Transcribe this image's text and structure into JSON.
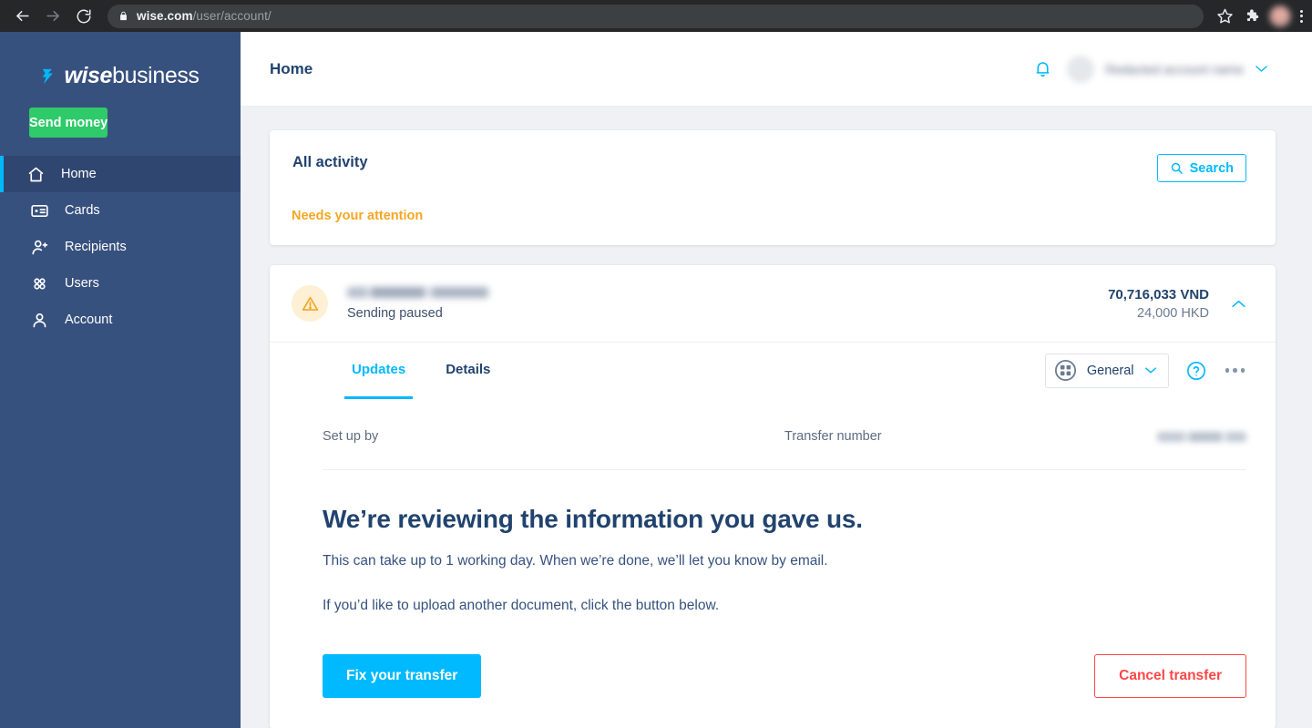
{
  "browser": {
    "back_icon": "arrow-left-icon",
    "forward_icon": "arrow-right-icon",
    "reload_icon": "reload-icon",
    "lock_icon": "lock-icon",
    "url_domain": "wise.com",
    "url_path": "/user/account/",
    "bookmark_icon": "star-icon",
    "extensions_icon": "puzzle-icon",
    "profile_icon": "profile-avatar",
    "menu_icon": "three-dots-vertical-icon"
  },
  "sidebar": {
    "logo_primary": "wise",
    "logo_secondary": "business",
    "send_money_label": "Send money",
    "items": [
      {
        "label": "Home",
        "icon": "home-icon",
        "active": true
      },
      {
        "label": "Cards",
        "icon": "card-icon",
        "active": false
      },
      {
        "label": "Recipients",
        "icon": "recipients-icon",
        "active": false
      },
      {
        "label": "Users",
        "icon": "users-grid-icon",
        "active": false
      },
      {
        "label": "Account",
        "icon": "person-icon",
        "active": false
      }
    ]
  },
  "header": {
    "title": "Home",
    "notifications_icon": "bell-icon",
    "account_name": "",
    "account_chevron_icon": "chevron-down-icon"
  },
  "activity": {
    "title": "All activity",
    "search_label": "Search",
    "search_icon": "search-icon",
    "needs_attention_label": "Needs your attention"
  },
  "transfer": {
    "status_icon": "warning-triangle-icon",
    "recipient_name": "",
    "status_label": "Sending paused",
    "amount_source": "70,716,033 VND",
    "amount_target": "24,000 HKD",
    "collapse_icon": "chevron-up-icon",
    "tabs": [
      {
        "label": "Updates",
        "active": true
      },
      {
        "label": "Details",
        "active": false
      }
    ],
    "category_label": "General",
    "category_icon": "category-grid-icon",
    "help_icon": "help-circle-icon",
    "more_icon": "three-dots-horizontal-icon",
    "details": [
      {
        "label": "Set up by",
        "value": ""
      },
      {
        "label": "Transfer number",
        "value": ""
      }
    ],
    "headline": "We’re reviewing the information you gave us.",
    "paragraph_1": "This can take up to 1 working day. When we’re done, we’ll let you know by email.",
    "paragraph_2": "If you’d like to upload another document, click the button below.",
    "primary_action": "Fix your transfer",
    "danger_action": "Cancel transfer"
  },
  "colors": {
    "accent_cyan": "#00b9ff",
    "brand_navy": "#21436e",
    "sidebar_navy": "#37517e",
    "success_green": "#2fca6a",
    "warning_orange": "#f5a623",
    "danger_red": "#ff4646"
  }
}
